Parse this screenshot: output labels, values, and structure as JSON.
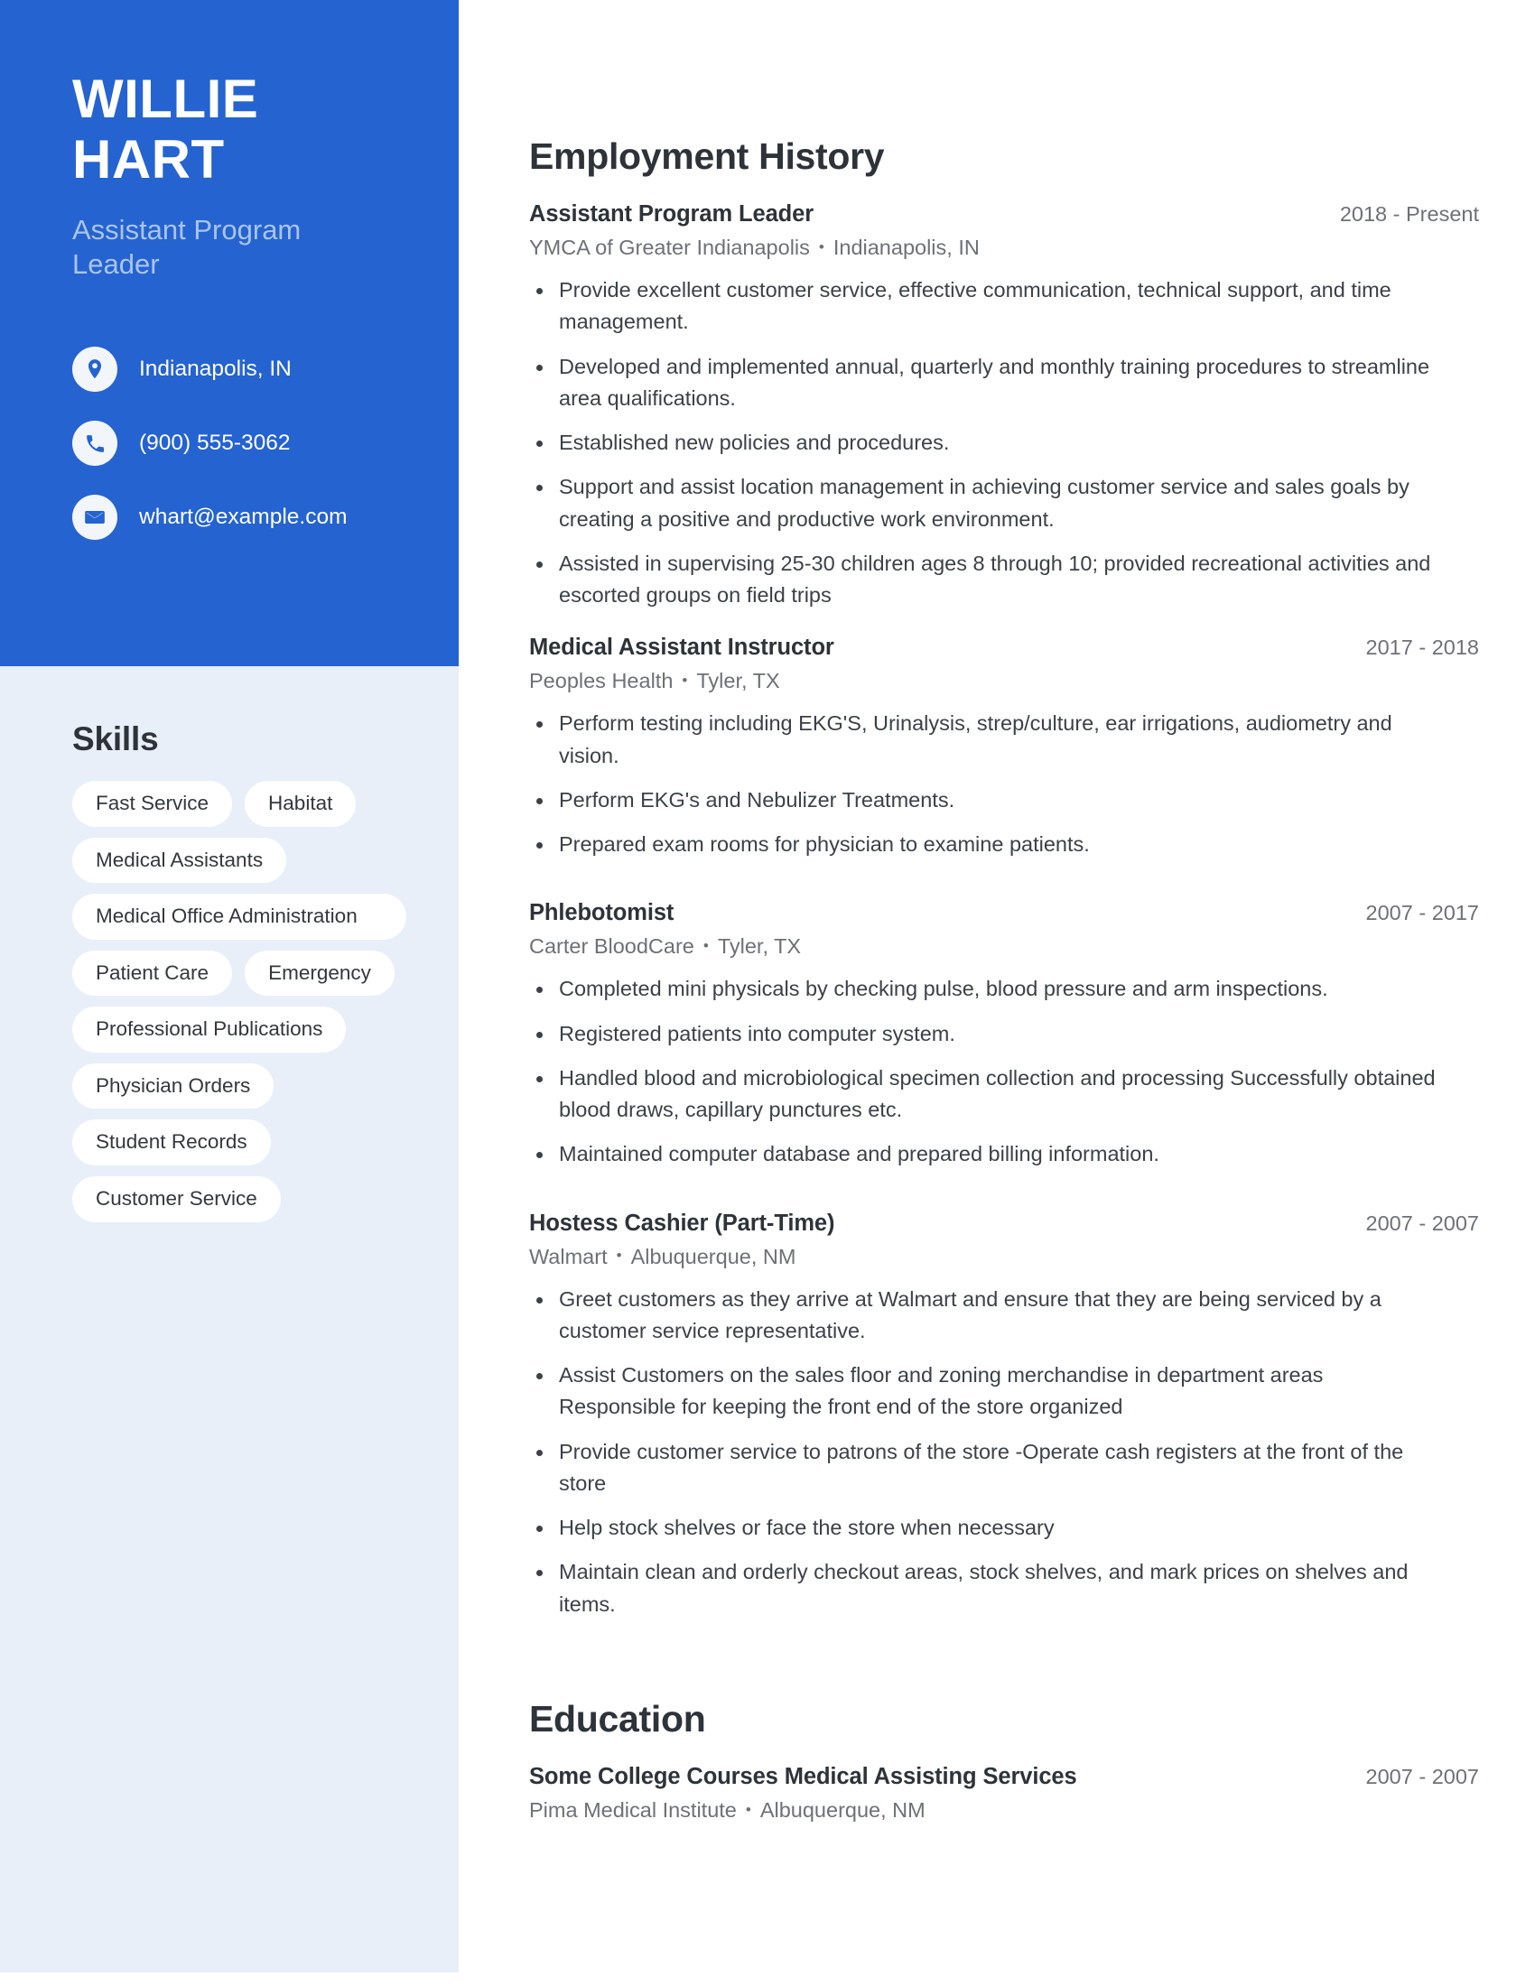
{
  "theme": {
    "accent_blue": "#2563D0",
    "sidebar_light": "#E8EFF9",
    "chip_bg": "#FFFFFF",
    "heading_color": "#2E3339",
    "muted_color": "#6D7176",
    "subtitle_color": "#A9C4E9"
  },
  "header": {
    "first_name": "WILLIE",
    "last_name": "HART",
    "job_title": "Assistant Program Leader"
  },
  "contact": {
    "location": {
      "icon": "location-pin-icon",
      "value": "Indianapolis, IN"
    },
    "phone": {
      "icon": "phone-icon",
      "value": "(900) 555-3062"
    },
    "email": {
      "icon": "envelope-icon",
      "value": "whart@example.com"
    }
  },
  "skills": {
    "title": "Skills",
    "items": [
      {
        "label": "Fast Service",
        "full_width": false
      },
      {
        "label": "Habitat",
        "full_width": false
      },
      {
        "label": "Medical Assistants",
        "full_width": false
      },
      {
        "label": "Medical Office Administration",
        "full_width": true
      },
      {
        "label": "Patient Care",
        "full_width": false
      },
      {
        "label": "Emergency",
        "full_width": false
      },
      {
        "label": "Professional Publications",
        "full_width": false
      },
      {
        "label": "Physician Orders",
        "full_width": false
      },
      {
        "label": "Student Records",
        "full_width": false
      },
      {
        "label": "Customer Service",
        "full_width": false
      }
    ]
  },
  "employment": {
    "title": "Employment History",
    "entries": [
      {
        "job_title": "Assistant Program Leader",
        "dates": "2018 - Present",
        "company": "YMCA of Greater Indianapolis",
        "location": "Indianapolis, IN",
        "bullets": [
          "Provide excellent customer service, effective communication, technical support, and time management.",
          "Developed and implemented annual, quarterly and monthly training procedures to streamline area qualifications.",
          "Established new policies and procedures.",
          "Support and assist location management in achieving customer service and sales goals by creating a positive and productive work environment.",
          "Assisted in supervising 25-30 children ages 8 through 10; provided recreational activities and escorted groups on field trips"
        ]
      },
      {
        "job_title": "Medical Assistant Instructor",
        "dates": "2017 - 2018",
        "company": "Peoples Health",
        "location": "Tyler, TX",
        "bullets": [
          "Perform testing including EKG'S, Urinalysis, strep/culture, ear irrigations, audiometry and vision.",
          "Perform EKG's and Nebulizer Treatments.",
          "Prepared exam rooms for physician to examine patients."
        ]
      },
      {
        "job_title": "Phlebotomist",
        "dates": "2007 - 2017",
        "company": "Carter BloodCare",
        "location": "Tyler, TX",
        "bullets": [
          "Completed mini physicals by checking pulse, blood pressure and arm inspections.",
          "Registered patients into computer system.",
          "Handled blood and microbiological specimen collection and processing Successfully obtained blood draws, capillary punctures etc.",
          "Maintained computer database and prepared billing information."
        ]
      },
      {
        "job_title": "Hostess Cashier (Part-Time)",
        "dates": "2007 - 2007",
        "company": "Walmart",
        "location": "Albuquerque, NM",
        "bullets": [
          "Greet customers as they arrive at Walmart and ensure that they are being serviced by a customer service representative.",
          "Assist Customers on the sales floor and zoning merchandise in department areas Responsible for keeping the front end of the store organized",
          "Provide customer service to patrons of the store -Operate cash registers at the front of the store",
          "Help stock shelves or face the store when necessary",
          "Maintain clean and orderly checkout areas, stock shelves, and mark prices on shelves and items."
        ]
      }
    ]
  },
  "education": {
    "title": "Education",
    "entries": [
      {
        "degree": "Some College Courses Medical Assisting Services",
        "dates": "2007 - 2007",
        "school": "Pima Medical Institute",
        "location": "Albuquerque, NM"
      }
    ]
  },
  "separator": "•"
}
